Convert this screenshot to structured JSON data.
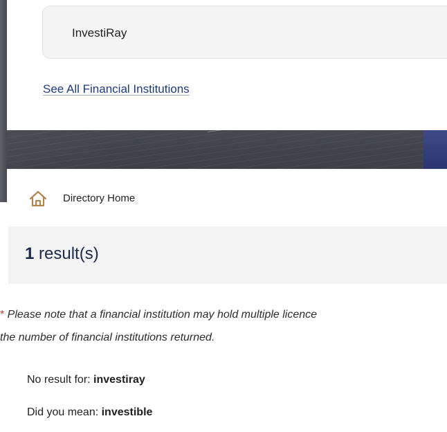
{
  "search_panel": {
    "suggestion": "InvestiRay",
    "see_all_link": "See All Financial Institutions"
  },
  "breadcrumb": {
    "home_label": "Directory Home"
  },
  "results": {
    "count": "1",
    "label": " result(s)"
  },
  "note": {
    "asterisk": "*",
    "line1": " Please note that a financial institution may hold multiple licence",
    "line2": "the number of financial institutions returned."
  },
  "no_result": {
    "prefix": "No result for: ",
    "term": "investiray"
  },
  "did_you_mean": {
    "prefix": "Did you mean: ",
    "term": "investible"
  },
  "colors": {
    "link": "#1e3a7b",
    "home_icon": "#b08552",
    "title": "#1a2a4e"
  }
}
